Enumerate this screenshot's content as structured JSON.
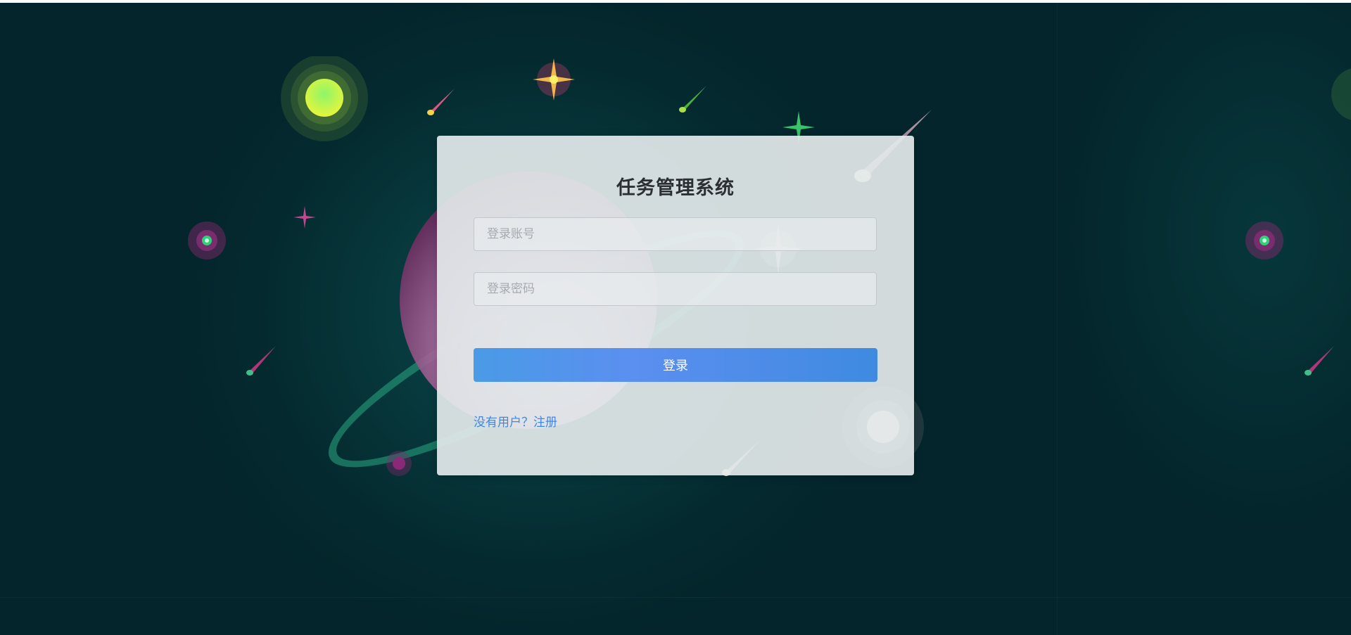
{
  "login": {
    "title": "任务管理系统",
    "username_placeholder": "登录账号",
    "password_placeholder": "登录密码",
    "login_button": "登录",
    "register_link": "没有用户？注册"
  },
  "colors": {
    "background": "#03252b",
    "card": "#e2e8ea",
    "primary_button": "#4a90e2",
    "link": "#3d87e6"
  }
}
